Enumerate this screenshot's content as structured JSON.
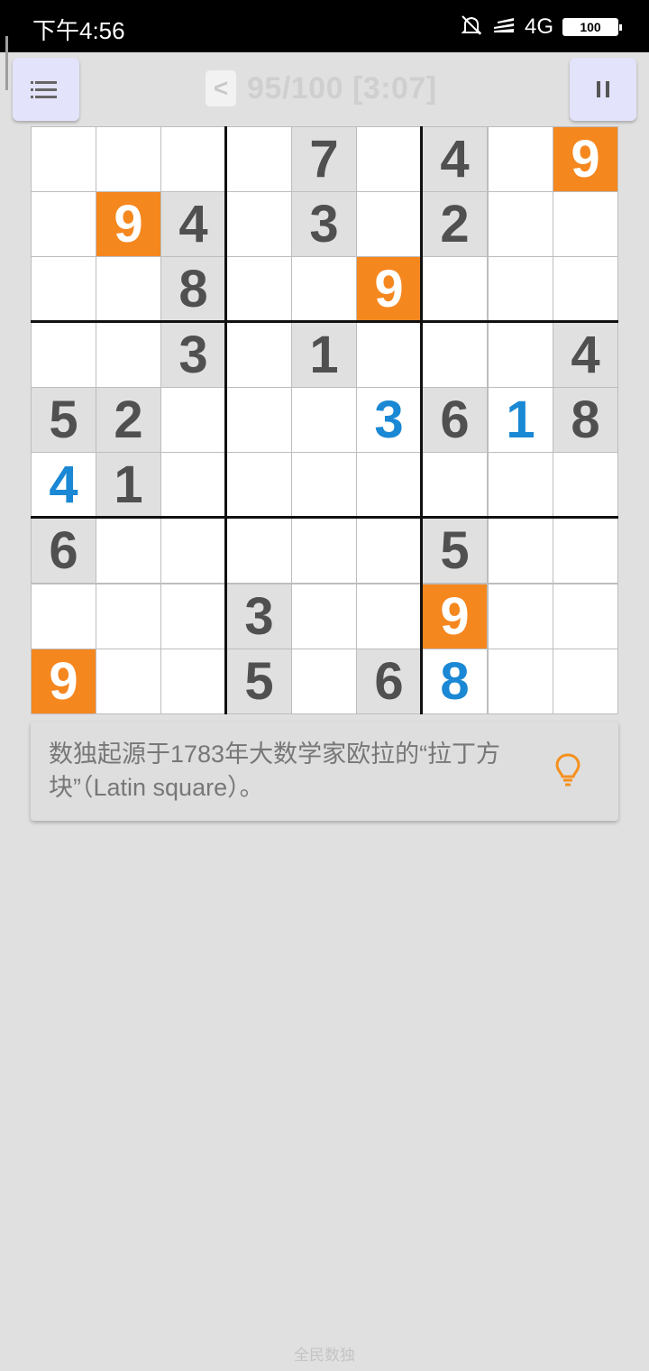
{
  "status_bar": {
    "time": "下午4:56",
    "network": "4G",
    "battery": "100",
    "icons": [
      "bell-off-icon",
      "signal-icon",
      "battery-icon"
    ]
  },
  "toolbar": {
    "menu_icon": "list-icon",
    "back_label": "<",
    "level_text": "95/100 [3:07]",
    "pause_icon": "pause-icon"
  },
  "board": {
    "rows": [
      [
        {
          "v": ""
        },
        {
          "v": ""
        },
        {
          "v": ""
        },
        {
          "v": ""
        },
        {
          "v": "7",
          "t": "given"
        },
        {
          "v": ""
        },
        {
          "v": "4",
          "t": "given"
        },
        {
          "v": ""
        },
        {
          "v": "9",
          "t": "orange"
        }
      ],
      [
        {
          "v": ""
        },
        {
          "v": "9",
          "t": "orange"
        },
        {
          "v": "4",
          "t": "given"
        },
        {
          "v": ""
        },
        {
          "v": "3",
          "t": "given"
        },
        {
          "v": ""
        },
        {
          "v": "2",
          "t": "given"
        },
        {
          "v": ""
        },
        {
          "v": ""
        }
      ],
      [
        {
          "v": ""
        },
        {
          "v": ""
        },
        {
          "v": "8",
          "t": "given"
        },
        {
          "v": ""
        },
        {
          "v": ""
        },
        {
          "v": "9",
          "t": "orange"
        },
        {
          "v": ""
        },
        {
          "v": ""
        },
        {
          "v": ""
        }
      ],
      [
        {
          "v": ""
        },
        {
          "v": ""
        },
        {
          "v": "3",
          "t": "given"
        },
        {
          "v": ""
        },
        {
          "v": "1",
          "t": "given"
        },
        {
          "v": ""
        },
        {
          "v": ""
        },
        {
          "v": ""
        },
        {
          "v": "4",
          "t": "given"
        }
      ],
      [
        {
          "v": "5",
          "t": "given"
        },
        {
          "v": "2",
          "t": "given"
        },
        {
          "v": ""
        },
        {
          "v": ""
        },
        {
          "v": ""
        },
        {
          "v": "3",
          "t": "blue"
        },
        {
          "v": "6",
          "t": "given"
        },
        {
          "v": "1",
          "t": "blue"
        },
        {
          "v": "8",
          "t": "given"
        }
      ],
      [
        {
          "v": "4",
          "t": "blue"
        },
        {
          "v": "1",
          "t": "given"
        },
        {
          "v": ""
        },
        {
          "v": ""
        },
        {
          "v": ""
        },
        {
          "v": ""
        },
        {
          "v": ""
        },
        {
          "v": ""
        },
        {
          "v": ""
        }
      ],
      [
        {
          "v": "6",
          "t": "given"
        },
        {
          "v": ""
        },
        {
          "v": ""
        },
        {
          "v": ""
        },
        {
          "v": ""
        },
        {
          "v": ""
        },
        {
          "v": "5",
          "t": "given"
        },
        {
          "v": ""
        },
        {
          "v": ""
        }
      ],
      [
        {
          "v": ""
        },
        {
          "v": ""
        },
        {
          "v": ""
        },
        {
          "v": "3",
          "t": "given"
        },
        {
          "v": ""
        },
        {
          "v": ""
        },
        {
          "v": "9",
          "t": "orange"
        },
        {
          "v": ""
        },
        {
          "v": ""
        }
      ],
      [
        {
          "v": "9",
          "t": "orange"
        },
        {
          "v": ""
        },
        {
          "v": ""
        },
        {
          "v": "5",
          "t": "given"
        },
        {
          "v": ""
        },
        {
          "v": "6",
          "t": "given"
        },
        {
          "v": "8",
          "t": "blue"
        },
        {
          "v": ""
        },
        {
          "v": ""
        }
      ]
    ]
  },
  "tip": {
    "text": "数独起源于1783年大数学家欧拉的“拉丁方块”（Latin square）。",
    "icon": "lightbulb-icon"
  },
  "footer": {
    "text": "全民数独"
  },
  "colors": {
    "highlight": "#f5871f",
    "user_entry": "#1a88d4",
    "given_bg": "#e0e0e0",
    "button_bg": "#e3e3fb"
  }
}
